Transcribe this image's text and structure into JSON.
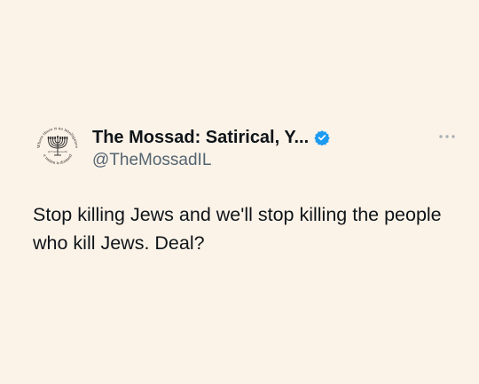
{
  "tweet": {
    "author": {
      "display_name": "The Mossad: Satirical, Y...",
      "handle": "@TheMossadIL",
      "avatar_top_text": "Where there is no intelligence",
      "avatar_middle_text": "@TheMossadIL",
      "avatar_bottom_text": "a nation is doomed",
      "verified": true
    },
    "text": "Stop killing Jews and we'll stop killing the people who kill Jews. Deal?",
    "more_icon": "more-horizontal-icon"
  },
  "colors": {
    "background": "#fcf3e8",
    "text": "#0f1419",
    "secondary": "#536471",
    "verified": "#1d9bf0"
  }
}
